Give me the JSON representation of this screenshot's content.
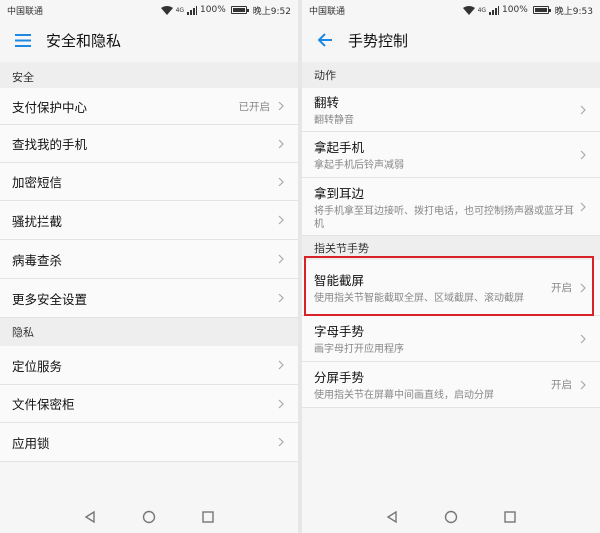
{
  "left": {
    "status": {
      "carrier": "中国联通",
      "battery": "100%",
      "time": "晚上9:52",
      "network": "4G"
    },
    "appbar": {
      "title": "安全和隐私",
      "lead_icon": "menu-icon"
    },
    "sections": [
      {
        "header": "安全",
        "items": [
          {
            "label": "支付保护中心",
            "value": "已开启"
          },
          {
            "label": "查找我的手机",
            "value": ""
          },
          {
            "label": "加密短信",
            "value": ""
          },
          {
            "label": "骚扰拦截",
            "value": ""
          },
          {
            "label": "病毒查杀",
            "value": ""
          },
          {
            "label": "更多安全设置",
            "value": ""
          }
        ]
      },
      {
        "header": "隐私",
        "items": [
          {
            "label": "定位服务",
            "value": ""
          },
          {
            "label": "文件保密柜",
            "value": ""
          },
          {
            "label": "应用锁",
            "value": ""
          }
        ]
      }
    ]
  },
  "right": {
    "status": {
      "carrier": "中国联通",
      "battery": "100%",
      "time": "晚上9:53",
      "network": "4G"
    },
    "appbar": {
      "title": "手势控制",
      "lead_icon": "back-arrow-icon"
    },
    "sections": [
      {
        "header": "动作",
        "items": [
          {
            "label": "翻转",
            "sub": "翻转静音",
            "value": ""
          },
          {
            "label": "拿起手机",
            "sub": "拿起手机后铃声减弱",
            "value": ""
          },
          {
            "label": "拿到耳边",
            "sub": "将手机拿至耳边接听、拨打电话，也可控制扬声器或蓝牙耳机",
            "value": ""
          }
        ]
      },
      {
        "header": "指关节手势",
        "items": [
          {
            "label": "智能截屏",
            "sub": "使用指关节智能截取全屏、区域截屏、滚动截屏",
            "value": "开启"
          },
          {
            "label": "字母手势",
            "sub": "画字母打开应用程序",
            "value": ""
          },
          {
            "label": "分屏手势",
            "sub": "使用指关节在屏幕中间画直线，启动分屏",
            "value": "开启"
          }
        ]
      }
    ]
  },
  "colors": {
    "accent": "#1e88e5",
    "highlight": "#d8222a",
    "section_bg": "#eeeeee",
    "row_bg": "#fafafa"
  },
  "navbar": {
    "icons": [
      "back-triangle-icon",
      "home-circle-icon",
      "recents-square-icon"
    ]
  }
}
